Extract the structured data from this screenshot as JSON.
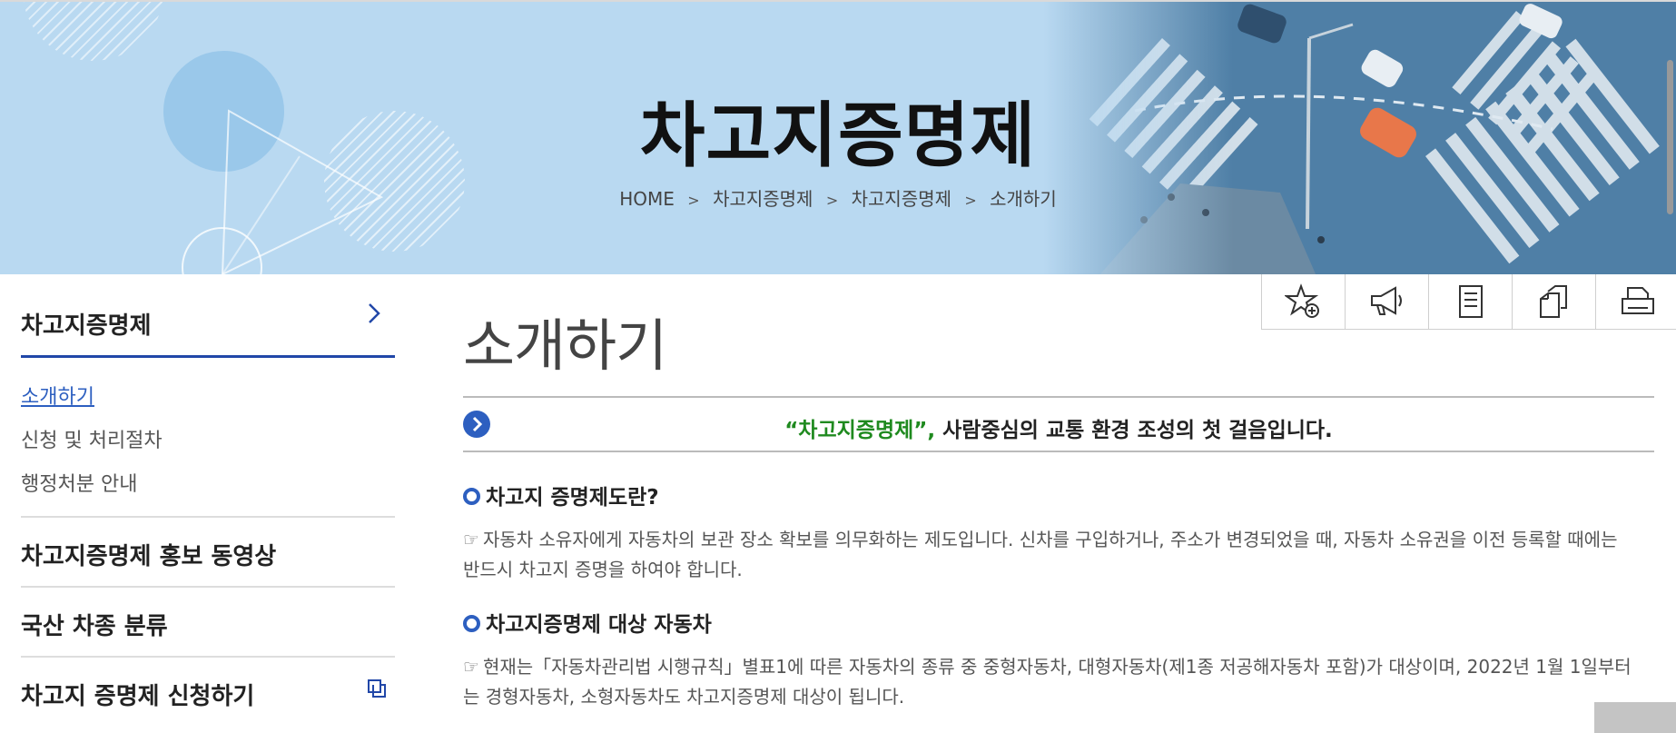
{
  "banner": {
    "title": "차고지증명제",
    "breadcrumb": [
      {
        "label": "HOME"
      },
      {
        "label": "차고지증명제"
      },
      {
        "label": "차고지증명제"
      },
      {
        "label": "소개하기"
      }
    ],
    "breadcrumb_separator": ">"
  },
  "sidebar": {
    "header": "차고지증명제",
    "sub_items": [
      {
        "label": "소개하기",
        "active": true
      },
      {
        "label": "신청 및 처리절차"
      },
      {
        "label": "행정처분 안내"
      }
    ],
    "items": [
      {
        "label": "차고지증명제 홍보 동영상"
      },
      {
        "label": "국산 차종 분류"
      },
      {
        "label": "차고지 증명제 신청하기",
        "icon": "external-window-icon"
      }
    ]
  },
  "tools": [
    {
      "icon": "favorite-star-icon"
    },
    {
      "icon": "megaphone-icon"
    },
    {
      "icon": "document-icon"
    },
    {
      "icon": "copy-icon"
    },
    {
      "icon": "print-icon"
    }
  ],
  "main": {
    "page_title": "소개하기",
    "slogan": {
      "quoted": "“차고지증명제”,",
      "rest": " 사람중심의 교통 환경 조성의 첫 걸음입니다."
    },
    "sections": [
      {
        "heading": "차고지 증명제도란?",
        "hand": "☞",
        "text": "자동차 소유자에게 자동차의 보관 장소 확보를 의무화하는 제도입니다. 신차를 구입하거나, 주소가 변경되었을 때, 자동차 소유권을 이전 등록할 때에는 반드시 차고지 증명을 하여야 합니다."
      },
      {
        "heading": "차고지증명제 대상 자동차",
        "hand": "☞",
        "text": "현재는「자동차관리법 시행규칙」별표1에 따른 자동차의 종류 중 중형자동차, 대형자동차(제1종 저공해자동차 포함)가 대상이며, 2022년 1월 1일부터는 경형자동차, 소형자동차도 차고지증명제 대상이 됩니다."
      }
    ]
  },
  "colors": {
    "accent": "#2147a8",
    "link_active": "#2d5fc0",
    "slogan_green": "#1f8a1f",
    "banner_bg": "#b9d9f1"
  }
}
